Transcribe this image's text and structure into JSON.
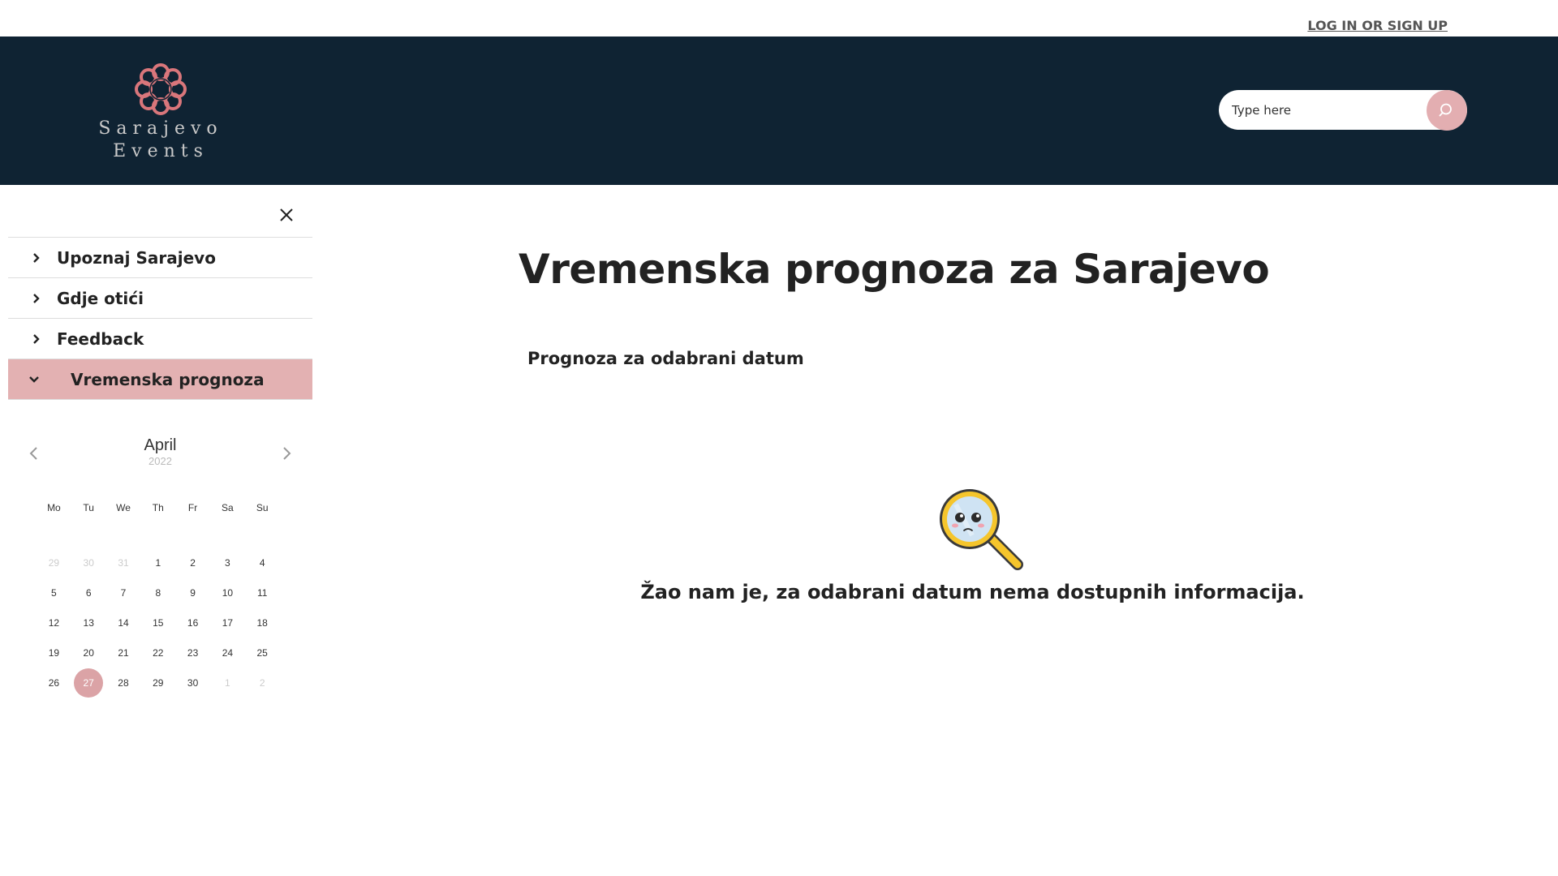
{
  "topbar": {
    "login_label": "LOG IN OR SIGN UP"
  },
  "header": {
    "logo_line1": "Sarajevo",
    "logo_line2": "Events",
    "search_placeholder": "Type here"
  },
  "sidebar": {
    "items": [
      {
        "label": "Upoznaj Sarajevo"
      },
      {
        "label": "Gdje otići"
      },
      {
        "label": "Feedback"
      },
      {
        "label": "Vremenska prognoza",
        "active": true
      }
    ]
  },
  "calendar": {
    "month": "April",
    "year": "2022",
    "weekdays": [
      "Mo",
      "Tu",
      "We",
      "Th",
      "Fr",
      "Sa",
      "Su"
    ],
    "weeks": [
      [
        "29",
        "30",
        "31",
        "1",
        "2",
        "3",
        "4"
      ],
      [
        "5",
        "6",
        "7",
        "8",
        "9",
        "10",
        "11"
      ],
      [
        "12",
        "13",
        "14",
        "15",
        "16",
        "17",
        "18"
      ],
      [
        "19",
        "20",
        "21",
        "22",
        "23",
        "24",
        "25"
      ],
      [
        "26",
        "27",
        "28",
        "29",
        "30",
        "1",
        "2"
      ]
    ],
    "selected": "27"
  },
  "main": {
    "title": "Vremenska prognoza za Sarajevo",
    "subtitle": "Prognoza za odabrani datum",
    "empty_message": "Žao nam je, za odabrani datum nema dostupnih informacija."
  },
  "colors": {
    "header_bg": "#0f2333",
    "accent": "#e3aeb1",
    "active_nav": "#e3b1b2"
  }
}
